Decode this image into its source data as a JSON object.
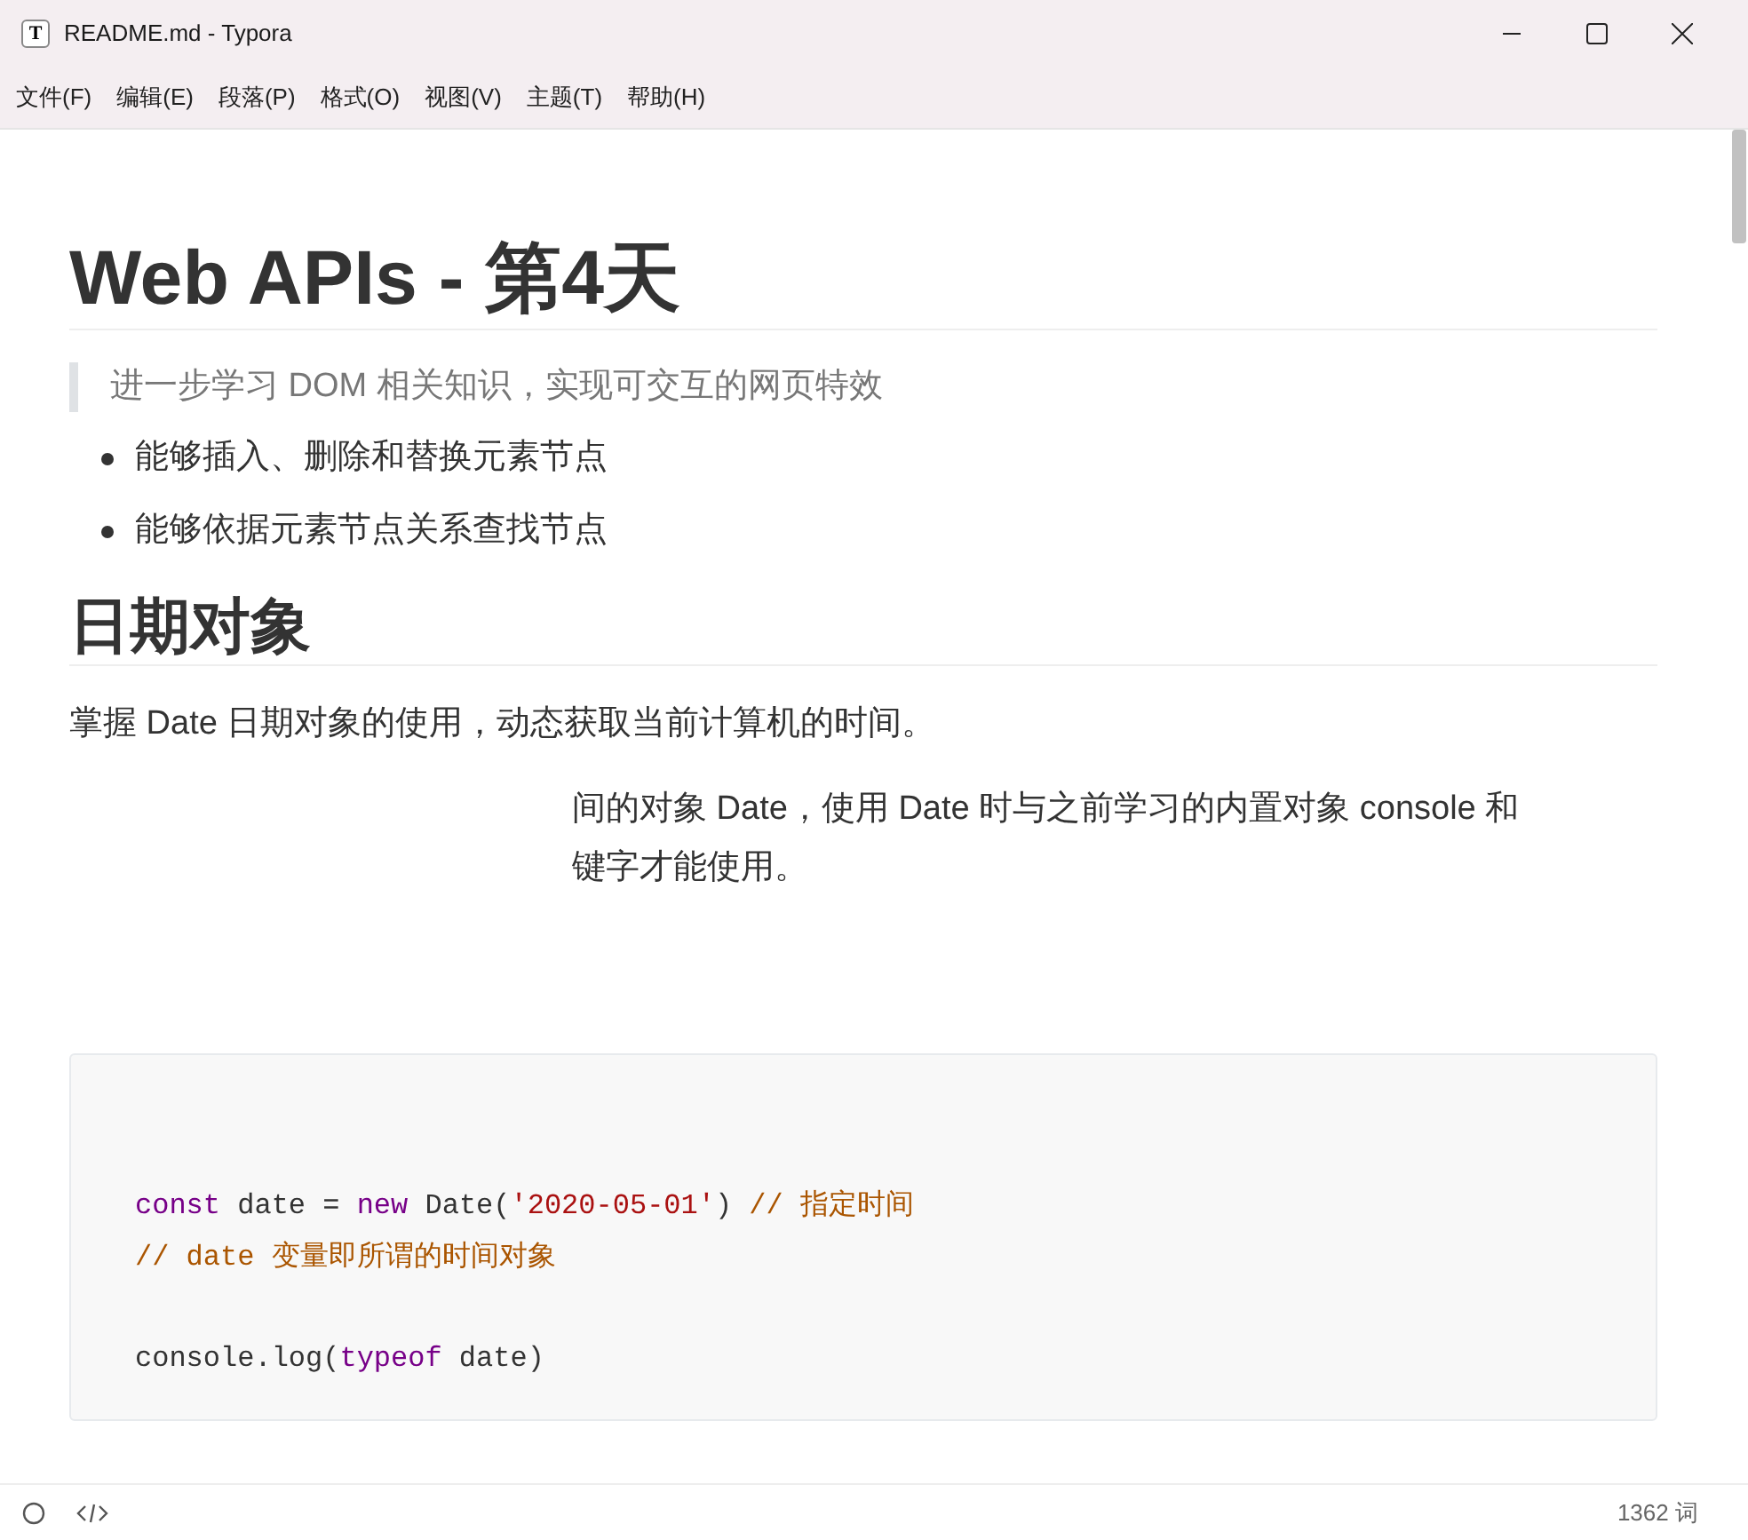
{
  "window": {
    "title": "README.md - Typora",
    "icon_letter": "T"
  },
  "menu": [
    "文件(F)",
    "编辑(E)",
    "段落(P)",
    "格式(O)",
    "视图(V)",
    "主题(T)",
    "帮助(H)"
  ],
  "document": {
    "title": "Web APIs - 第4天",
    "quote": "进一步学习 DOM 相关知识，实现可交互的网页特效",
    "bullets": [
      "能够插入、删除和替换元素节点",
      "能够依据元素节点关系查找节点"
    ],
    "section": "日期对象",
    "intro": "掌握 Date 日期对象的使用，动态获取当前计算机的时间。",
    "partial_lines": [
      "间的对象 Date，使用 Date 时与之前学习的内置对象 console 和",
      "键字才能使用。"
    ],
    "code_lines": [
      {
        "kind": "blank"
      },
      {
        "kind": "blank"
      },
      {
        "kind": "code",
        "tokens": [
          {
            "kind": "keyword",
            "s": "const"
          },
          {
            "kind": "plain",
            "s": " date = "
          },
          {
            "kind": "keyword",
            "s": "new"
          },
          {
            "kind": "plain",
            "s": " Date("
          },
          {
            "kind": "string",
            "s": "'2020-05-01'"
          },
          {
            "kind": "plain",
            "s": ") "
          },
          {
            "kind": "comment",
            "s": "// 指定时间"
          }
        ]
      },
      {
        "kind": "code",
        "tokens": [
          {
            "kind": "comment",
            "s": "// date 变量即所谓的时间对象"
          }
        ]
      },
      {
        "kind": "blank"
      },
      {
        "kind": "code",
        "tokens": [
          {
            "kind": "plain",
            "s": "console.log("
          },
          {
            "kind": "keyword",
            "s": "typeof"
          },
          {
            "kind": "plain",
            "s": " date)"
          }
        ]
      }
    ]
  },
  "status_bar": {
    "word_count": "1362 词"
  }
}
